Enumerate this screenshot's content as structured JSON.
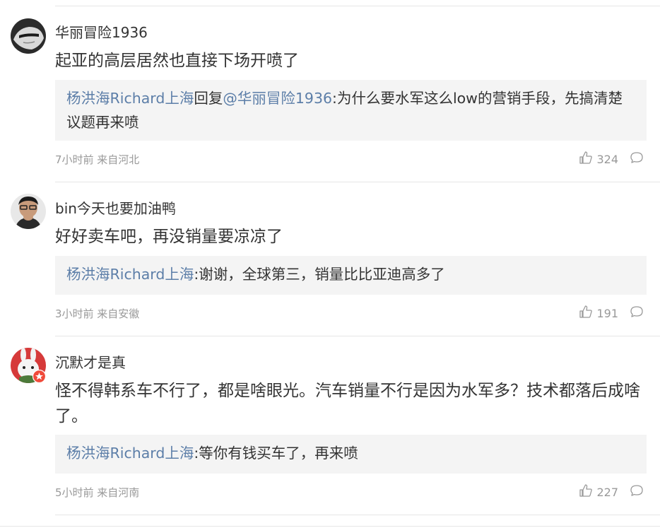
{
  "comments": [
    {
      "username": "华丽冒险1936",
      "text": "起亚的高层居然也直接下场开喷了",
      "reply": {
        "user": "杨洪海Richard上海",
        "reply_word": "回复",
        "mention": "@华丽冒险1936",
        "text": ":为什么要水军这么low的营销手段，先搞清楚议题再来喷"
      },
      "meta": "7小时前 来自河北",
      "likes": "324"
    },
    {
      "username": "bin今天也要加油鸭",
      "text": "好好卖车吧，再没销量要凉凉了",
      "reply": {
        "user": "杨洪海Richard上海",
        "text": ":谢谢，全球第三，销量比比亚迪高多了"
      },
      "meta": "3小时前 来自安徽",
      "likes": "191"
    },
    {
      "username": "沉默才是真",
      "text": "怪不得韩系车不行了，都是啥眼光。汽车销量不行是因为水军多？技术都落后成啥了。",
      "reply": {
        "user": "杨洪海Richard上海",
        "text": ":等你有钱买车了，再来喷"
      },
      "meta": "5小时前 来自河南",
      "likes": "227"
    }
  ],
  "icons": {
    "like": "thumbs-up-icon",
    "reply": "comment-bubble-icon"
  },
  "colors": {
    "link": "#5c7ea8",
    "meta": "#999999",
    "reply_bg": "#f4f4f4",
    "text": "#333333"
  }
}
